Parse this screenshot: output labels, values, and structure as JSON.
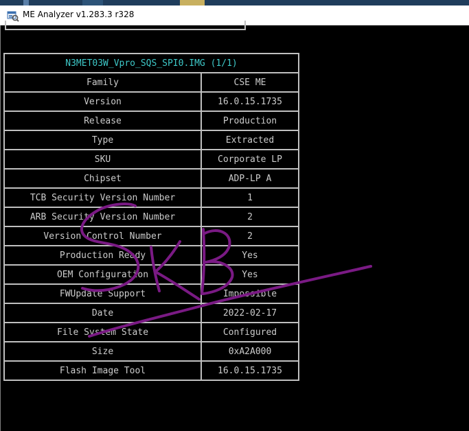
{
  "window": {
    "title": "ME Analyzer v1.283.3 r328",
    "icon": "me-analyzer-app-icon"
  },
  "table": {
    "header": "N3MET03W_Vpro_SQS_SPI0.IMG (1/1)",
    "rows": [
      {
        "label": "Family",
        "value": "CSE ME"
      },
      {
        "label": "Version",
        "value": "16.0.15.1735"
      },
      {
        "label": "Release",
        "value": "Production"
      },
      {
        "label": "Type",
        "value": "Extracted"
      },
      {
        "label": "SKU",
        "value": "Corporate LP"
      },
      {
        "label": "Chipset",
        "value": "ADP-LP A"
      },
      {
        "label": "TCB Security Version Number",
        "value": "1"
      },
      {
        "label": "ARB Security Version Number",
        "value": "2"
      },
      {
        "label": "Version Control Number",
        "value": "2"
      },
      {
        "label": "Production Ready",
        "value": "Yes"
      },
      {
        "label": "OEM Configuration",
        "value": "Yes"
      },
      {
        "label": "FWUpdate Support",
        "value": "Impossible"
      },
      {
        "label": "Date",
        "value": "2022-02-17"
      },
      {
        "label": "File System State",
        "value": "Configured"
      },
      {
        "label": "Size",
        "value": "0xA2A000"
      },
      {
        "label": "Flash Image Tool",
        "value": "16.0.15.1735"
      }
    ]
  },
  "annotation": {
    "ink_color": "#7a1a84"
  }
}
